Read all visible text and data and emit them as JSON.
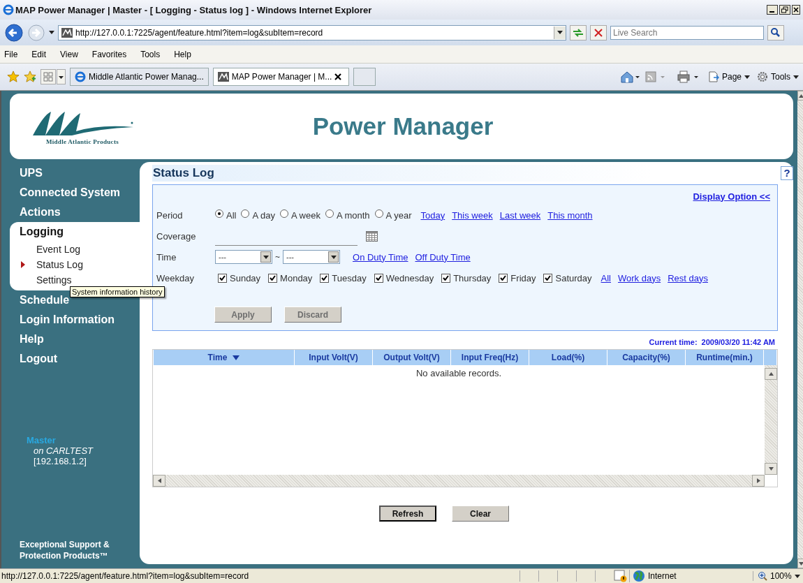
{
  "window": {
    "title": "MAP Power Manager | Master - [ Logging - Status log ] - Windows Internet Explorer"
  },
  "address_bar": {
    "url": "http://127.0.0.1:7225/agent/feature.html?item=log&subItem=record",
    "search_placeholder": "Live Search"
  },
  "menu": [
    "File",
    "Edit",
    "View",
    "Favorites",
    "Tools",
    "Help"
  ],
  "tabs": [
    {
      "label": "Middle Atlantic Power Manag...",
      "selected": false
    },
    {
      "label": "MAP Power Manager | M...",
      "selected": true
    }
  ],
  "command_bar": [
    "Page",
    "Tools"
  ],
  "header": {
    "logo_text": "Middle Atlantic Products",
    "title": "Power Manager"
  },
  "sidebar": {
    "items": [
      {
        "label": "UPS",
        "selected": false
      },
      {
        "label": "Connected System",
        "selected": false
      },
      {
        "label": "Actions",
        "selected": false
      },
      {
        "label": "Logging",
        "selected": true,
        "children": [
          {
            "label": "Event Log",
            "selected": false
          },
          {
            "label": "Status Log",
            "selected": true
          },
          {
            "label": "Settings",
            "selected": false
          }
        ]
      },
      {
        "label": "Schedule",
        "selected": false
      },
      {
        "label": "Login Information",
        "selected": false
      },
      {
        "label": "Help",
        "selected": false
      },
      {
        "label": "Logout",
        "selected": false
      }
    ],
    "tooltip": "System information history",
    "device": {
      "role": "Master",
      "host": "on CARLTEST",
      "ip": "[192.168.1.2]"
    },
    "footer": "Exceptional Support & Protection Products™"
  },
  "main": {
    "title": "Status Log",
    "help": "?",
    "display_option": "Display Option <<",
    "period": {
      "label": "Period",
      "options": [
        {
          "label": "All",
          "selected": true
        },
        {
          "label": "A day",
          "selected": false
        },
        {
          "label": "A week",
          "selected": false
        },
        {
          "label": "A month",
          "selected": false
        },
        {
          "label": "A year",
          "selected": false
        }
      ],
      "links": [
        "Today",
        "This week",
        "Last week",
        "This month"
      ]
    },
    "coverage": {
      "label": "Coverage"
    },
    "time": {
      "label": "Time",
      "from": "---",
      "separator": "~",
      "to": "---",
      "links": [
        "On Duty Time",
        "Off Duty Time"
      ]
    },
    "weekday": {
      "label": "Weekday",
      "days": [
        {
          "label": "Sunday",
          "checked": true
        },
        {
          "label": "Monday",
          "checked": true
        },
        {
          "label": "Tuesday",
          "checked": true
        },
        {
          "label": "Wednesday",
          "checked": true
        },
        {
          "label": "Thursday",
          "checked": true
        },
        {
          "label": "Friday",
          "checked": true
        },
        {
          "label": "Saturday",
          "checked": true
        }
      ],
      "links": [
        "All",
        "Work days",
        "Rest days"
      ]
    },
    "buttons": [
      {
        "label": "Apply",
        "disabled": true
      },
      {
        "label": "Discard",
        "disabled": true
      }
    ],
    "current_time": {
      "label": "Current time:",
      "value": "2009/03/20 11:42 AM"
    },
    "table": {
      "columns": [
        {
          "label": "Time",
          "sorted": true
        },
        {
          "label": "Input Volt(V)",
          "sorted": false
        },
        {
          "label": "Output Volt(V)",
          "sorted": false
        },
        {
          "label": "Input Freq(Hz)",
          "sorted": false
        },
        {
          "label": "Load(%)",
          "sorted": false
        },
        {
          "label": "Capacity(%)",
          "sorted": false
        },
        {
          "label": "Runtime(min.)",
          "sorted": false
        }
      ],
      "empty_message": "No available records."
    },
    "actions": [
      {
        "label": "Refresh",
        "default": true
      },
      {
        "label": "Clear",
        "default": false
      }
    ]
  },
  "status_bar": {
    "url": "http://127.0.0.1:7225/agent/feature.html?item=log&subItem=record",
    "zone": "Internet",
    "zoom": "100%"
  }
}
